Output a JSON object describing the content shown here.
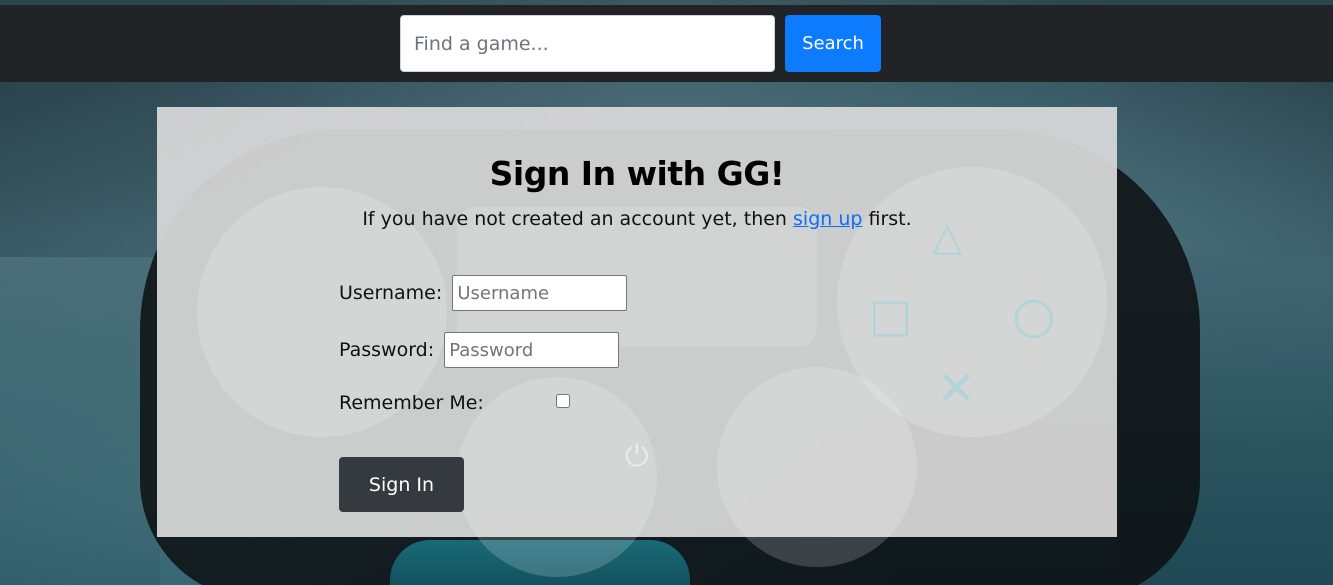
{
  "navbar": {
    "search_placeholder": "Find a game...",
    "search_button_label": "Search"
  },
  "signin_card": {
    "title": "Sign In with GG!",
    "subtitle_prefix": "If you have not created an account yet, then ",
    "signup_link_label": "sign up",
    "subtitle_suffix": " first.",
    "username_label": "Username:",
    "username_placeholder": "Username",
    "password_label": "Password:",
    "password_placeholder": "Password",
    "remember_label": "Remember Me:",
    "remember_checked": false,
    "submit_label": "Sign In"
  },
  "colors": {
    "navbar_bg": "#212327",
    "search_button": "#0d7bfd",
    "signin_button": "#343a40",
    "link": "#0d6efd",
    "card_bg": "#d9d9d9"
  }
}
